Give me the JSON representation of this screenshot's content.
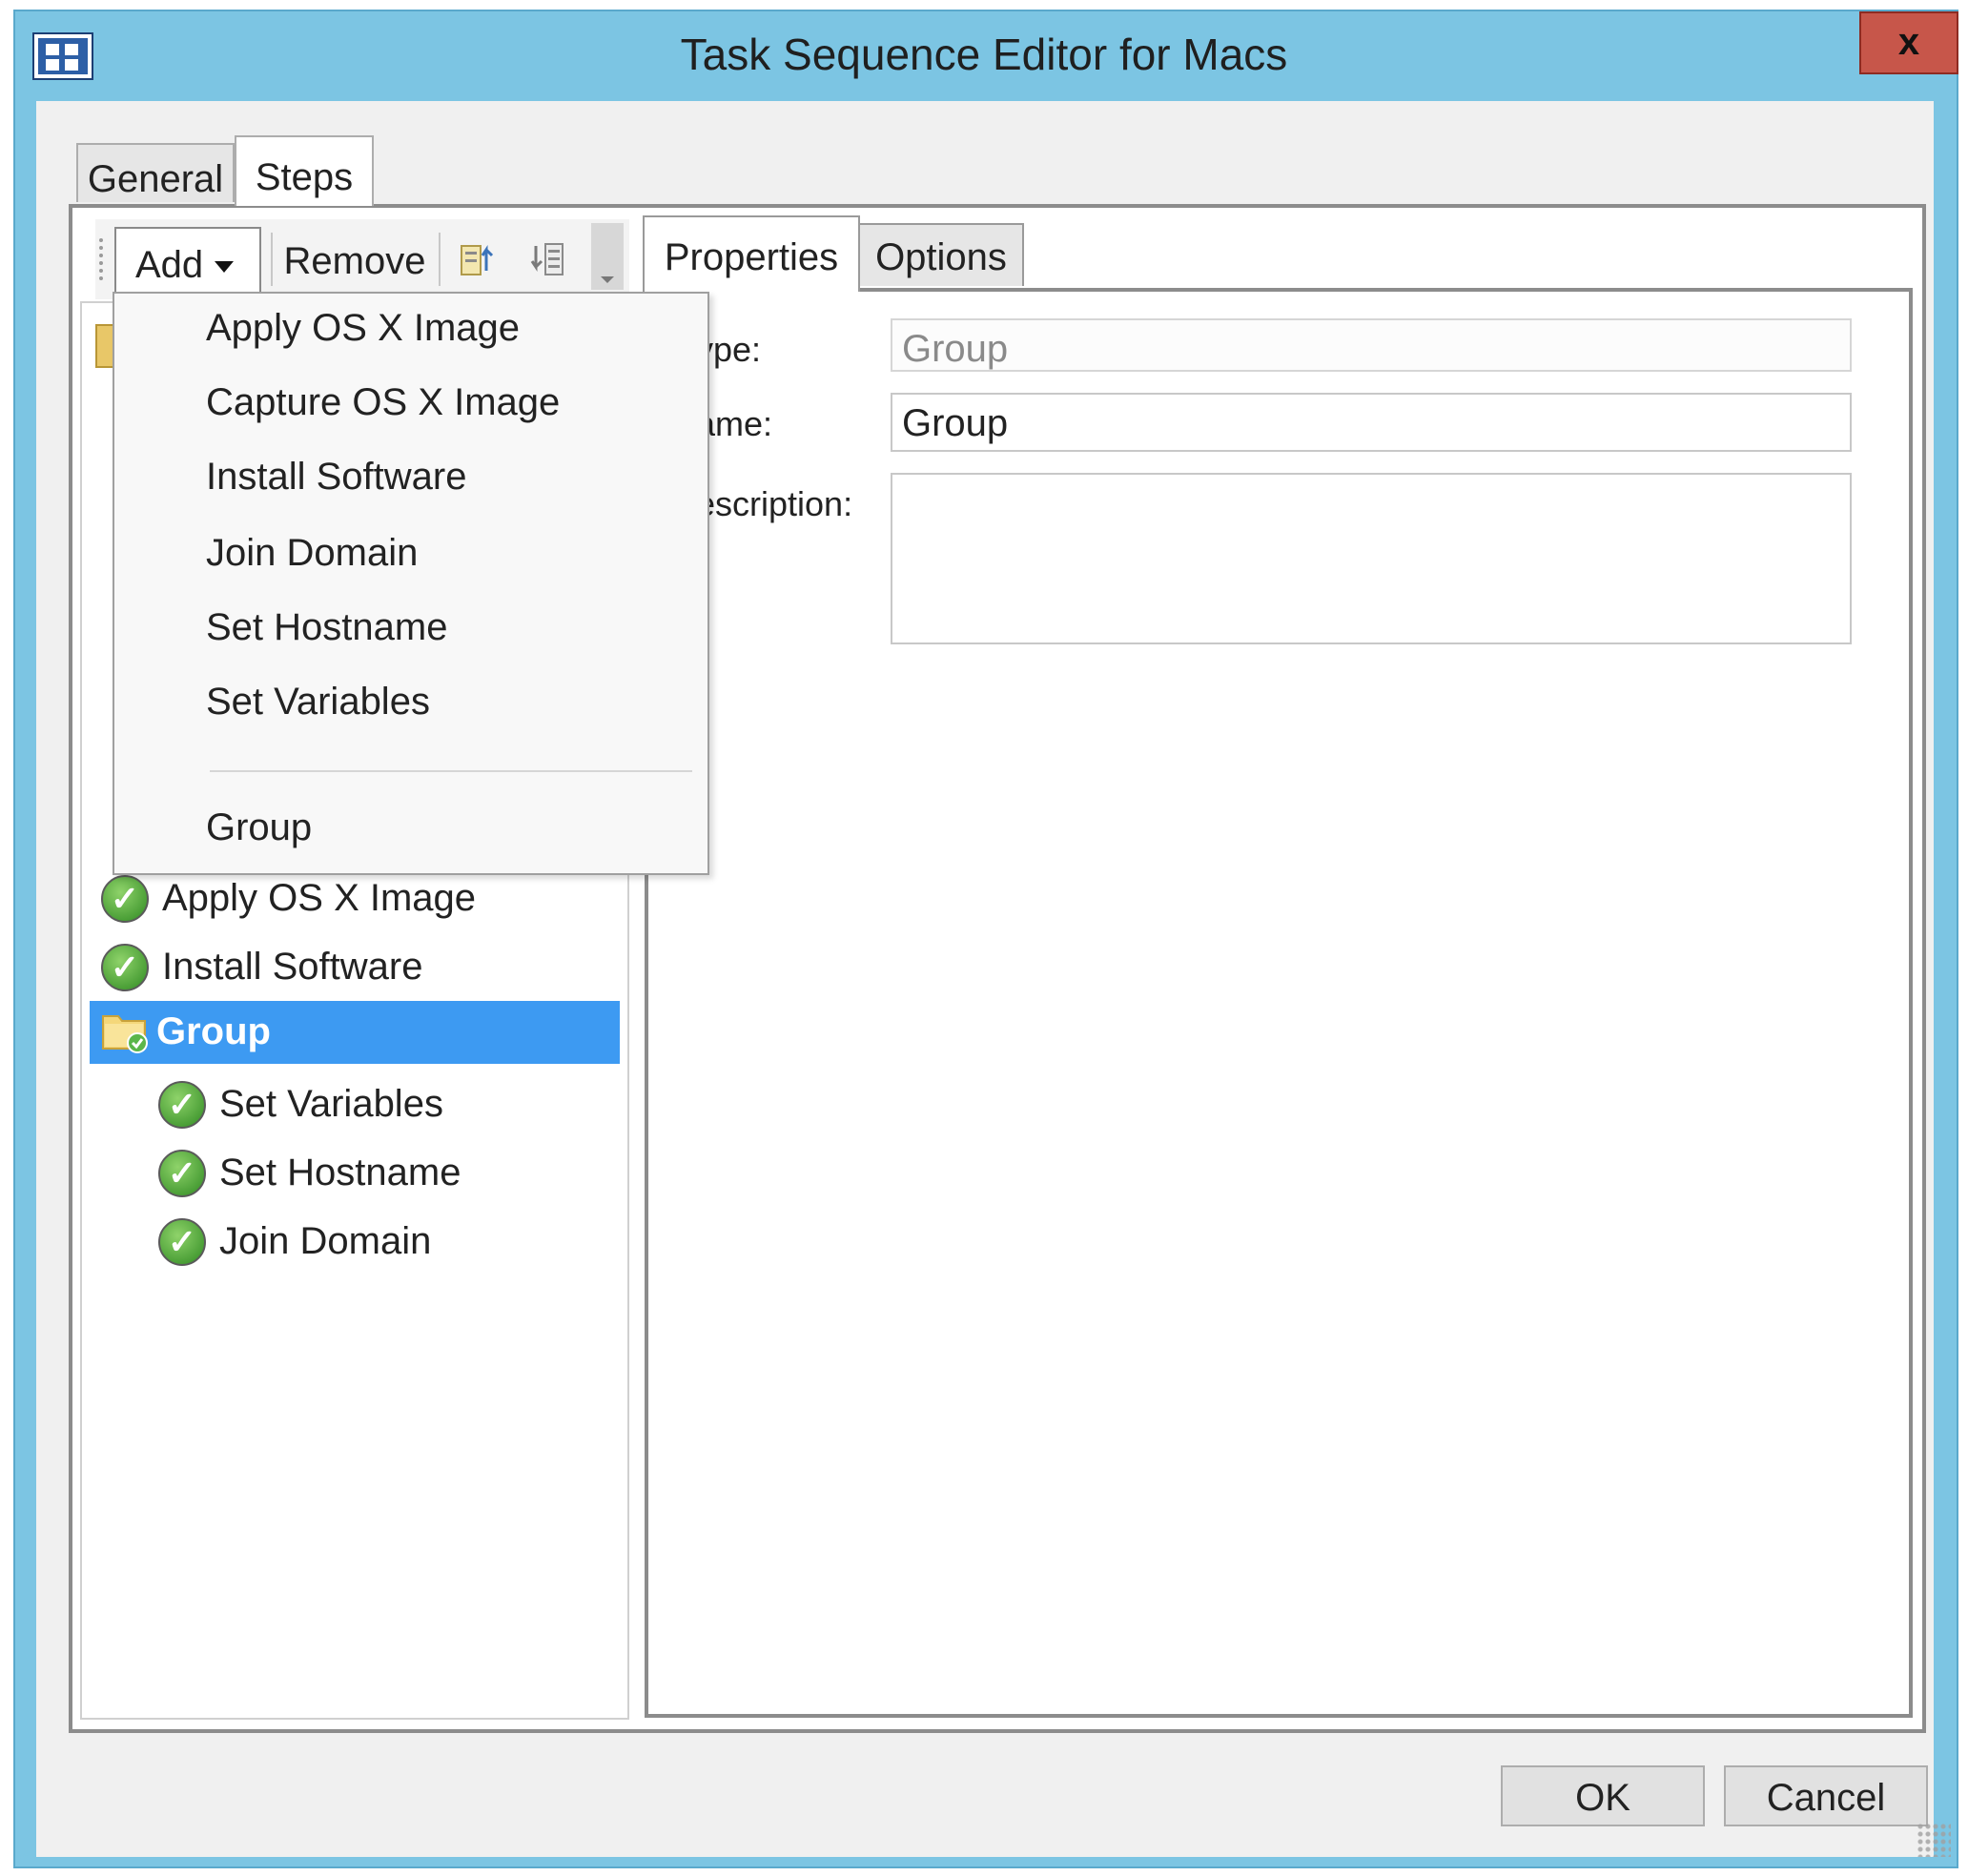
{
  "window": {
    "title": "Task Sequence Editor for Macs",
    "close_label": "x"
  },
  "tabs": [
    {
      "label": "General",
      "active": false
    },
    {
      "label": "Steps",
      "active": true
    }
  ],
  "toolbar": {
    "add_label": "Add",
    "remove_label": "Remove",
    "icons": [
      "move-up-icon",
      "move-down-icon"
    ]
  },
  "add_menu": {
    "items": [
      {
        "label": "Apply OS X Image"
      },
      {
        "label": "Capture OS X Image"
      },
      {
        "label": "Install Software"
      },
      {
        "label": "Join Domain"
      },
      {
        "label": "Set Hostname"
      },
      {
        "label": "Set Variables"
      },
      {
        "label": "Group"
      }
    ]
  },
  "tree": {
    "items": [
      {
        "label": "Apply OS X Image",
        "icon": "check-icon",
        "level": 0,
        "selected": false
      },
      {
        "label": "Install Software",
        "icon": "check-icon",
        "level": 0,
        "selected": false
      },
      {
        "label": "Group",
        "icon": "folder-icon",
        "level": 0,
        "selected": true
      },
      {
        "label": "Set Variables",
        "icon": "check-icon",
        "level": 1,
        "selected": false
      },
      {
        "label": "Set Hostname",
        "icon": "check-icon",
        "level": 1,
        "selected": false
      },
      {
        "label": "Join Domain",
        "icon": "check-icon",
        "level": 1,
        "selected": false
      }
    ]
  },
  "detail_tabs": [
    {
      "label": "Properties",
      "active": true
    },
    {
      "label": "Options",
      "active": false
    }
  ],
  "properties": {
    "type_label": "ype:",
    "type_value": "Group",
    "name_label": "ame:",
    "name_value": "Group",
    "description_label": "escription:",
    "description_value": ""
  },
  "buttons": {
    "ok_label": "OK",
    "cancel_label": "Cancel"
  },
  "colors": {
    "title_bar": "#7cc5e3",
    "close_button": "#c7564a",
    "selection": "#3d9af2"
  }
}
